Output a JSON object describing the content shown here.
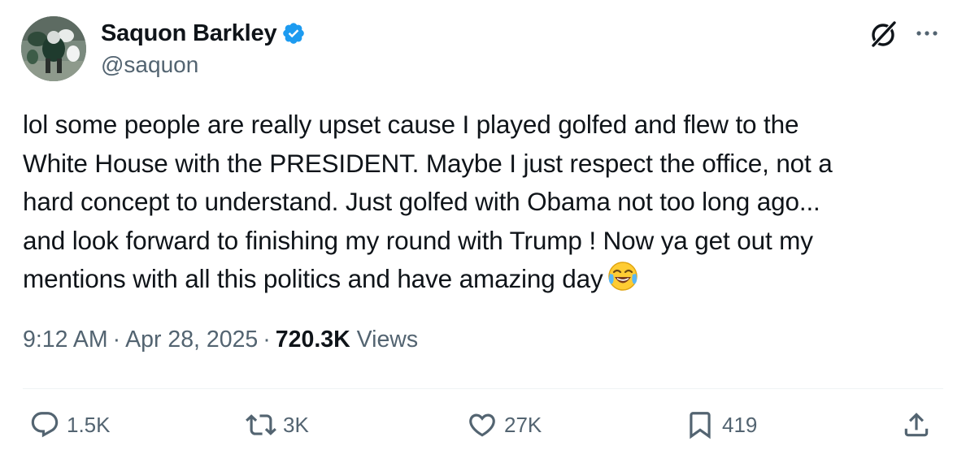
{
  "user": {
    "display_name": "Saquon Barkley",
    "handle": "@saquon",
    "verified": true,
    "avatar_icon": "avatar"
  },
  "header_icons": {
    "grok": "grok-icon",
    "more": "more-icon"
  },
  "tweet": {
    "text_lines": [
      "lol some people are really upset cause I played golfed and flew to the",
      "White House with the PRESIDENT. Maybe I just respect the office, not a",
      "hard concept to understand. Just golfed with Obama not too long ago...",
      "and look forward to finishing my round with Trump ! Now ya get out my",
      "mentions with all this politics and have amazing day"
    ],
    "emoji": "face-with-tears-of-joy-icon"
  },
  "meta": {
    "time": "9:12 AM",
    "separator": "·",
    "date": "Apr 28, 2025",
    "views_count": "720.3K",
    "views_label": "Views"
  },
  "actions": {
    "reply_count": "1.5K",
    "retweet_count": "3K",
    "like_count": "27K",
    "bookmark_count": "419"
  },
  "colors": {
    "text_primary": "#0f1419",
    "text_secondary": "#536471",
    "verified_blue": "#1d9bf0",
    "divider": "#eff3f4"
  }
}
